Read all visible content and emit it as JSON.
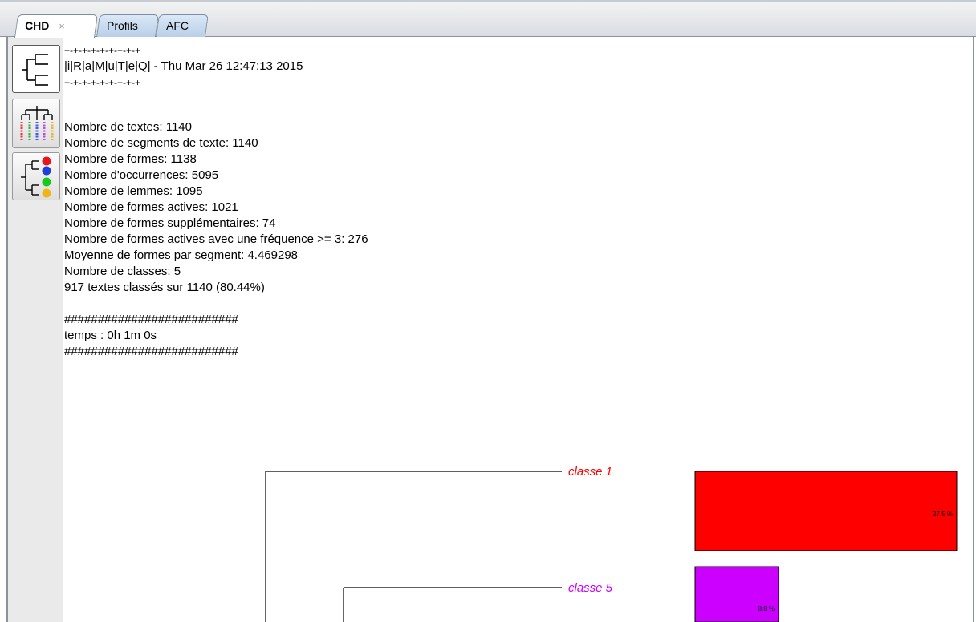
{
  "tabs": [
    {
      "label": "CHD",
      "close": "×",
      "active": true
    },
    {
      "label": "Profils",
      "active": false
    },
    {
      "label": "AFC",
      "active": false
    }
  ],
  "toolbar": {
    "buttons": [
      {
        "icon": "dendrogram-icon"
      },
      {
        "icon": "profiles-dendrogram-icon"
      },
      {
        "icon": "colored-dendrogram-icon"
      }
    ]
  },
  "report": {
    "separator_top": "+-+-+-+-+-+-+-+-+",
    "header": "|i|R|a|M|u|T|e|Q| - Thu Mar 26 12:47:13 2015",
    "separator_bottom": "+-+-+-+-+-+-+-+-+",
    "stats": [
      "Nombre de textes: 1140",
      "Nombre de segments de texte: 1140",
      "Nombre de formes: 1138",
      "Nombre d'occurrences: 5095",
      "Nombre de lemmes: 1095",
      "Nombre de formes actives: 1021",
      "Nombre de formes supplémentaires: 74",
      "Nombre de formes actives avec une fréquence >= 3: 276",
      "Moyenne de formes par segment: 4.469298",
      "Nombre de classes: 5",
      "917 textes classés sur 1140 (80.44%)"
    ],
    "hash_top": "##########################",
    "time": "temps : 0h 1m 0s",
    "hash_bottom": "##########################"
  },
  "dendrogram": {
    "classes": [
      {
        "label": "classe  1",
        "percent_label": "27.5 %",
        "percent": 27.5,
        "color": "#ff0000"
      },
      {
        "label": "classe  5",
        "percent_label": "8.8 %",
        "percent": 8.8,
        "color": "#cc00ff"
      }
    ]
  }
}
